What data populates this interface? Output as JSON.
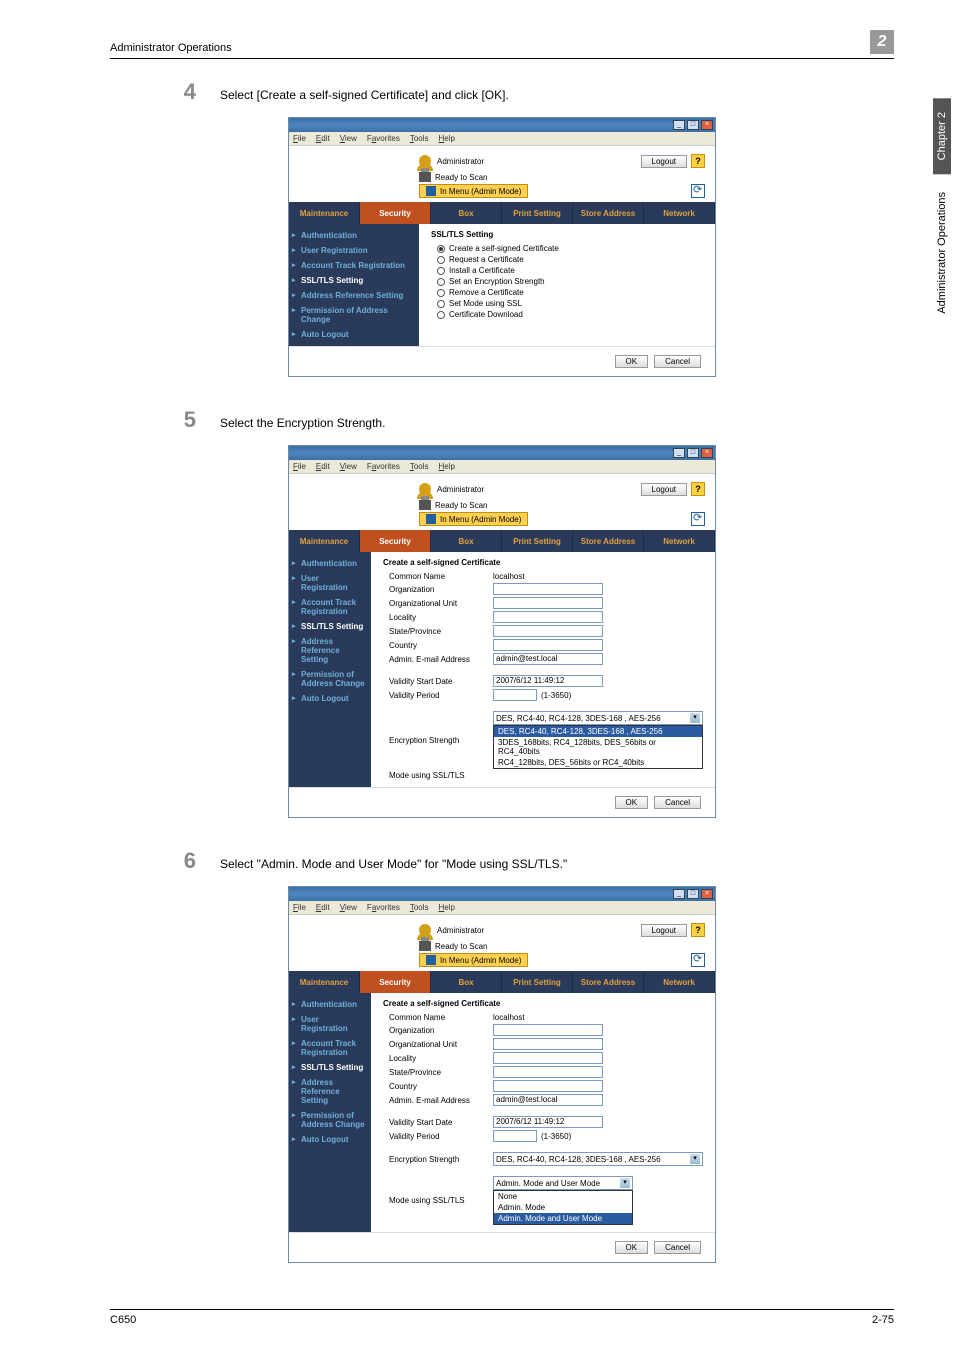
{
  "page_header": {
    "title": "Administrator Operations",
    "chapter_number": "2"
  },
  "side_tab": {
    "dark": "Chapter 2",
    "light": "Administrator Operations"
  },
  "steps": {
    "s4": {
      "num": "4",
      "text": "Select [Create a self-signed Certificate] and click [OK]."
    },
    "s5": {
      "num": "5",
      "text": "Select the Encryption Strength."
    },
    "s6": {
      "num": "6",
      "text": "Select \"Admin. Mode and User Mode\" for \"Mode using SSL/TLS.\""
    }
  },
  "menubar": {
    "file": "File",
    "edit": "Edit",
    "view": "View",
    "favorites": "Favorites",
    "tools": "Tools",
    "help": "Help"
  },
  "header": {
    "administrator": "Administrator",
    "logout": "Logout",
    "help": "?",
    "ready": "Ready to Scan",
    "inmenu": "In Menu (Admin Mode)"
  },
  "tabs": {
    "maintenance": "Maintenance",
    "security": "Security",
    "box": "Box",
    "print": "Print Setting",
    "store": "Store Address",
    "network": "Network"
  },
  "sidebar": {
    "items": [
      "Authentication",
      "User Registration",
      "Account Track Registration",
      "SSL/TLS Setting",
      "Address Reference Setting",
      "Permission of Address Change",
      "Auto Logout"
    ]
  },
  "screen4": {
    "title": "SSL/TLS Setting",
    "opts": [
      "Create a self-signed Certificate",
      "Request a Certificate",
      "Install a Certificate",
      "Set an Encryption Strength",
      "Remove a Certificate",
      "Set Mode using SSL",
      "Certificate Download"
    ]
  },
  "screen5": {
    "title": "Create a self-signed Certificate",
    "fields": {
      "common_name": "Common Name",
      "common_name_val": "localhost",
      "organization": "Organization",
      "org_unit": "Organizational Unit",
      "locality": "Locality",
      "state": "State/Province",
      "country": "Country",
      "admin_email": "Admin. E-mail Address",
      "admin_email_val": "admin@test.local",
      "validity_start": "Validity Start Date",
      "validity_start_val": "2007/6/12 11:49:12",
      "validity_period": "Validity Period",
      "validity_period_hint": "(1-3650)",
      "enc_strength": "Encryption Strength",
      "mode_ssl": "Mode using SSL/TLS"
    },
    "enc_selected": "DES, RC4-40, RC4-128, 3DES-168 , AES-256",
    "enc_options": [
      "DES, RC4-40, RC4-128, 3DES-168 , AES-256",
      "3DES_168bits, RC4_128bits, DES_56bits or RC4_40bits",
      "RC4_128bits, DES_56bits or RC4_40bits"
    ]
  },
  "screen6": {
    "mode_selected": "Admin. Mode and User Mode",
    "mode_options": [
      "None",
      "Admin. Mode",
      "Admin. Mode and User Mode"
    ]
  },
  "buttons": {
    "ok": "OK",
    "cancel": "Cancel"
  },
  "footer": {
    "left": "C650",
    "right": "2-75"
  }
}
